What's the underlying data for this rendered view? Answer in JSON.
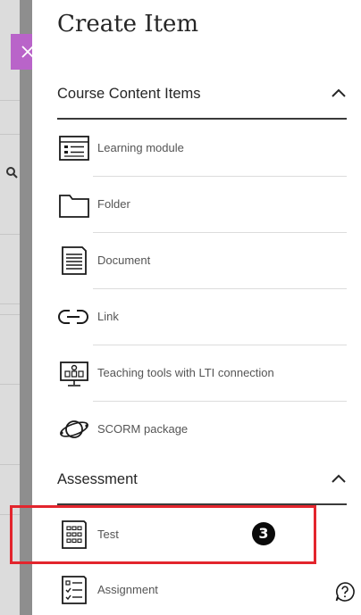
{
  "panel": {
    "title": "Create Item"
  },
  "sections": {
    "course_content": {
      "label": "Course Content Items",
      "items": [
        {
          "label": "Learning module",
          "icon": "learning-module-icon"
        },
        {
          "label": "Folder",
          "icon": "folder-icon"
        },
        {
          "label": "Document",
          "icon": "document-icon"
        },
        {
          "label": "Link",
          "icon": "link-icon"
        },
        {
          "label": "Teaching tools with LTI connection",
          "icon": "lti-tool-icon"
        },
        {
          "label": "SCORM package",
          "icon": "scorm-package-icon"
        }
      ]
    },
    "assessment": {
      "label": "Assessment",
      "items": [
        {
          "label": "Test",
          "icon": "test-icon"
        },
        {
          "label": "Assignment",
          "icon": "assignment-icon"
        }
      ]
    }
  },
  "annotation": {
    "step": "3"
  },
  "colors": {
    "close_tab": "#b964c9",
    "highlight": "#e3252d",
    "rule": "#3a3a3a"
  }
}
